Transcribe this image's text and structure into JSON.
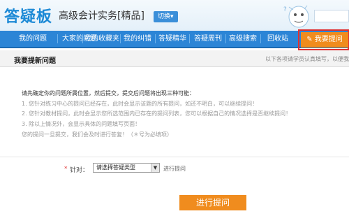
{
  "header": {
    "logo": "答疑板",
    "course": "高级会计实务[精品]",
    "switch_label": "切换▾"
  },
  "nav": {
    "items": [
      "我的问题",
      "大家的问题",
      "我的收藏夹",
      "我的纠错",
      "答疑精华",
      "答疑周刊",
      "高级搜索",
      "回收站"
    ],
    "active": "我要提问",
    "active_icon": "pencil-icon"
  },
  "subbar": {
    "title": "我要提新问题",
    "note": "以下各项请学员认真填写，以便我们"
  },
  "intro": {
    "lines": [
      "请先确定你的问题所属位置，然后提交，提交后问题将出现三种可能：",
      "1. 您针对练习中心的提问已经存在，此时会显示该题的所有提问，如还不明白，可以继续提问！",
      "2. 您针对教材提问，此时会显示您所选范围内已存在的提问列表，您可以根据自己的情况选择是否继续提问！",
      "3. 除以上情况外，会显示具体的问题填写页面！",
      "您的提问一旦提交，我们会及时进行答复！（＊号为必填项）"
    ]
  },
  "form": {
    "required_mark": "*",
    "label": "针对：",
    "select_value": "请选择答疑类型",
    "after_select": "进行提问"
  },
  "submit_label": "进行提问",
  "colors": {
    "brand": "#1d8ad6",
    "nav": "#2c85d6",
    "accent": "#f08c1e",
    "highlight": "#e03030"
  }
}
